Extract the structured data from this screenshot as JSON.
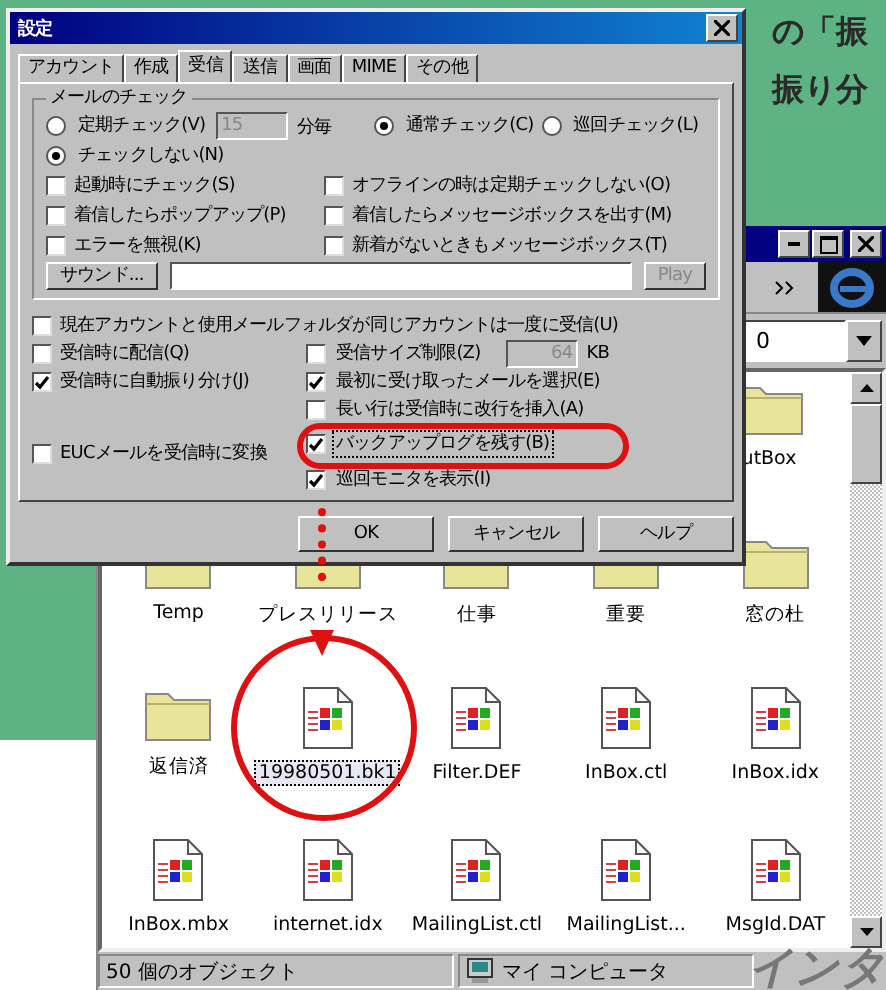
{
  "article_text": [
    "の「振",
    "振り分"
  ],
  "dialog": {
    "title": "設定",
    "tabs": [
      {
        "label": "アカウント",
        "selected": false
      },
      {
        "label": "作成",
        "selected": false
      },
      {
        "label": "受信",
        "selected": true
      },
      {
        "label": "送信",
        "selected": false
      },
      {
        "label": "画面",
        "selected": false
      },
      {
        "label": "MIME",
        "selected": false
      },
      {
        "label": "その他",
        "selected": false
      }
    ],
    "group": {
      "title": "メールのチェック",
      "rows": [
        [
          {
            "kind": "radio_interval",
            "label": "定期チェック(V)",
            "selected": false,
            "value": "15",
            "unit": "分毎",
            "disabled": true
          },
          {
            "kind": "radio",
            "label": "通常チェック(C)",
            "selected": true
          },
          {
            "kind": "radio",
            "label": "巡回チェック(L)",
            "selected": false
          }
        ],
        [
          {
            "kind": "radio",
            "label": "チェックしない(N)",
            "selected": true
          }
        ],
        [
          {
            "kind": "check",
            "label": "起動時にチェック(S)",
            "checked": false
          },
          {
            "kind": "check",
            "label": "オフラインの時は定期チェックしない(O)",
            "checked": false
          }
        ],
        [
          {
            "kind": "check",
            "label": "着信したらポップアップ(P)",
            "checked": false
          },
          {
            "kind": "check",
            "label": "着信したらメッセージボックスを出す(M)",
            "checked": false
          }
        ],
        [
          {
            "kind": "check",
            "label": "エラーを無視(K)",
            "checked": false
          },
          {
            "kind": "check",
            "label": "新着がないときもメッセージボックス(T)",
            "checked": false
          }
        ],
        [
          {
            "kind": "button",
            "label": "サウンド...",
            "disabled": false
          },
          {
            "kind": "text"
          },
          {
            "kind": "button",
            "label": "Play",
            "disabled": true
          }
        ]
      ]
    },
    "full_option": {
      "label": "現在アカウントと使用メールフォルダが同じアカウントは一度に受信(U)",
      "checked": false
    },
    "left_options": [
      {
        "label": "受信時に配信(Q)",
        "checked": false
      },
      {
        "label": "受信時に自動振り分け(J)",
        "checked": true
      },
      {
        "label": "EUCメールを受信時に変換",
        "checked": false
      }
    ],
    "right_options": [
      {
        "label": "受信サイズ制限(Z)",
        "checked": false,
        "value": "64",
        "unit": "KB"
      },
      {
        "label": "最初に受け取ったメールを選択(E)",
        "checked": true,
        "focused": false
      },
      {
        "label": "長い行は受信時に改行を挿入(A)",
        "checked": false,
        "focused": false
      },
      {
        "label": "バックアップログを残す(B)",
        "checked": true,
        "focused": true
      },
      {
        "label": "巡回モニタを表示(I)",
        "checked": true,
        "focused": false
      }
    ],
    "buttons": [
      {
        "label": "OK"
      },
      {
        "label": "キャンセル"
      },
      {
        "label": "ヘルプ"
      }
    ]
  },
  "explorer": {
    "address": "0",
    "file_rows": [
      [
        {
          "kind": "folder",
          "name": "utBox",
          "selected": false
        }
      ],
      [
        {
          "kind": "folder",
          "name": "Temp",
          "selected": false
        },
        {
          "kind": "folder",
          "name": "プレスリリース",
          "selected": false
        },
        {
          "kind": "folder",
          "name": "仕事",
          "selected": false
        },
        {
          "kind": "folder",
          "name": "重要",
          "selected": false
        },
        {
          "kind": "folder",
          "name": "窓の杜",
          "selected": false
        }
      ],
      [
        {
          "kind": "folder",
          "name": "返信済",
          "selected": false
        },
        {
          "kind": "file",
          "name": "19980501.bk1",
          "selected": true
        },
        {
          "kind": "file",
          "name": "Filter.DEF",
          "selected": false
        },
        {
          "kind": "file",
          "name": "InBox.ctl",
          "selected": false
        },
        {
          "kind": "file",
          "name": "InBox.idx",
          "selected": false
        }
      ],
      [
        {
          "kind": "file",
          "name": "InBox.mbx",
          "selected": false
        },
        {
          "kind": "file",
          "name": "internet.idx",
          "selected": false
        },
        {
          "kind": "file",
          "name": "MailingList.ctl",
          "selected": false
        },
        {
          "kind": "file",
          "name": "MailingList...",
          "selected": false
        },
        {
          "kind": "file",
          "name": "MsgId.DAT",
          "selected": false
        }
      ]
    ],
    "status": {
      "count": "50 個のオブジェクト",
      "location": "マイ コンピュータ"
    }
  },
  "corner_text": "インタ"
}
